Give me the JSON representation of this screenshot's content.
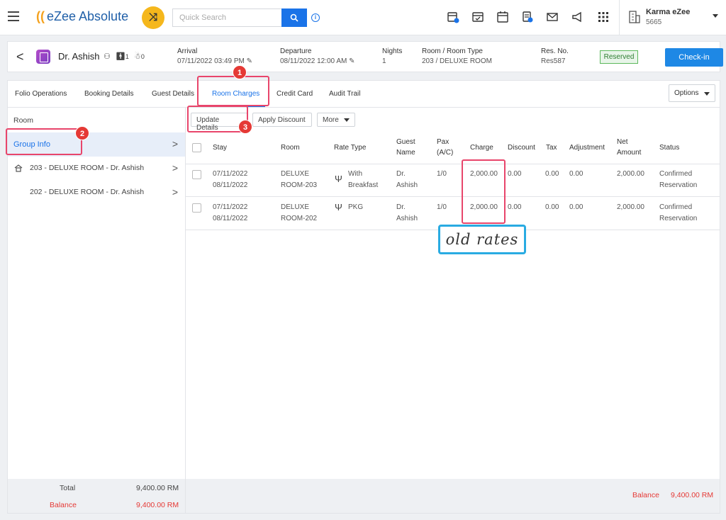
{
  "app": {
    "name": "eZee Absolute",
    "search_placeholder": "Quick Search"
  },
  "hotel": {
    "name": "Karma eZee",
    "code": "5665"
  },
  "reservation": {
    "guest_name": "Dr. Ashish",
    "adults": "1",
    "children": "0",
    "arrival_label": "Arrival",
    "arrival_value": "07/11/2022 03:49 PM",
    "departure_label": "Departure",
    "departure_value": "08/11/2022 12:00 AM",
    "nights_label": "Nights",
    "nights_value": "1",
    "room_label": "Room / Room Type",
    "room_value": "203 / DELUXE ROOM",
    "resno_label": "Res. No.",
    "resno_value": "Res587",
    "status_badge": "Reserved",
    "checkin_label": "Check-in"
  },
  "tabs": [
    "Folio Operations",
    "Booking Details",
    "Guest Details",
    "Room Charges",
    "Credit Card",
    "Audit Trail"
  ],
  "options_label": "Options",
  "left": {
    "header": "Room",
    "group_label": "Group Info",
    "rooms": [
      "203 - DELUXE ROOM - Dr. Ashish",
      "202 - DELUXE ROOM - Dr. Ashish"
    ],
    "total_label": "Total",
    "total_value": "9,400.00 RM",
    "balance_label": "Balance",
    "balance_value": "9,400.00 RM"
  },
  "actions": {
    "update": "Update Details",
    "discount": "Apply Discount",
    "more": "More"
  },
  "table": {
    "headers": {
      "stay": "Stay",
      "room": "Room",
      "rate_type": "Rate Type",
      "guest_1": "Guest",
      "guest_2": "Name",
      "pax_1": "Pax",
      "pax_2": "(A/C)",
      "charge": "Charge",
      "discount": "Discount",
      "tax": "Tax",
      "adjustment": "Adjustment",
      "net_1": "Net",
      "net_2": "Amount",
      "status": "Status"
    },
    "rows": [
      {
        "stay_from": "07/11/2022",
        "stay_to": "08/11/2022",
        "room_1": "DELUXE",
        "room_2": "ROOM-203",
        "rate_1": "With",
        "rate_2": "Breakfast",
        "guest_1": "Dr.",
        "guest_2": "Ashish",
        "pax": "1/0",
        "charge": "2,000.00",
        "discount": "0.00",
        "tax": "0.00",
        "adjustment": "0.00",
        "net": "2,000.00",
        "status_1": "Confirmed",
        "status_2": "Reservation"
      },
      {
        "stay_from": "07/11/2022",
        "stay_to": "08/11/2022",
        "room_1": "DELUXE",
        "room_2": "ROOM-202",
        "rate_1": "PKG",
        "rate_2": "",
        "guest_1": "Dr.",
        "guest_2": "Ashish",
        "pax": "1/0",
        "charge": "2,000.00",
        "discount": "0.00",
        "tax": "0.00",
        "adjustment": "0.00",
        "net": "2,000.00",
        "status_1": "Confirmed",
        "status_2": "Reservation"
      }
    ]
  },
  "bottom": {
    "balance_label": "Balance",
    "balance_value": "9,400.00 RM"
  },
  "annotations": {
    "n1": "1",
    "n2": "2",
    "n3": "3",
    "note": "old rates"
  },
  "colors": {
    "accent": "#1a73e8",
    "annotation": "#e8456b",
    "note_border": "#29abe2",
    "balance": "#e53935"
  }
}
